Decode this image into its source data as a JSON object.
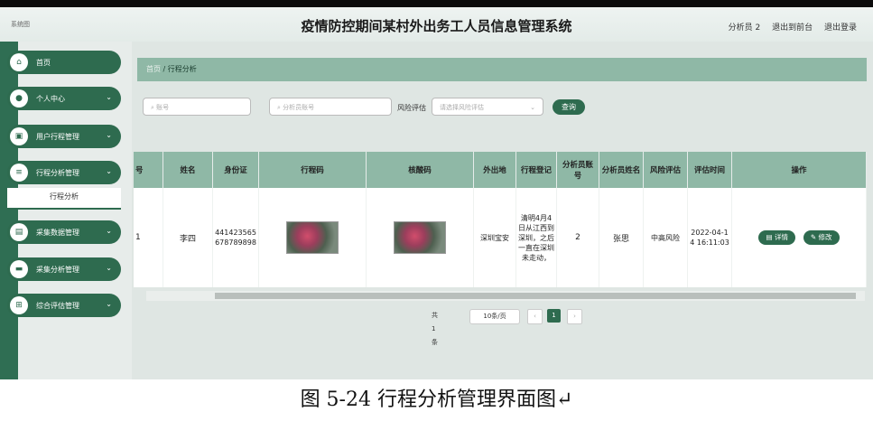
{
  "header": {
    "logo": "系统图",
    "title": "疫情防控期间某村外出务工人员信息管理系统",
    "user": "分析员 2",
    "front": "退出到前台",
    "logout": "退出登录"
  },
  "sidebar": {
    "items": [
      {
        "label": "首页",
        "icon": "home-icon",
        "glyph": "⌂"
      },
      {
        "label": "个人中心",
        "icon": "user-icon",
        "glyph": "●"
      },
      {
        "label": "用户行程管理",
        "icon": "clipboard-icon",
        "glyph": "▣"
      },
      {
        "label": "行程分析管理",
        "icon": "list-icon",
        "glyph": "≡"
      },
      {
        "label": "采集数据管理",
        "icon": "document-icon",
        "glyph": "▤"
      },
      {
        "label": "采集分析管理",
        "icon": "folder-icon",
        "glyph": "▬"
      },
      {
        "label": "综合评估管理",
        "icon": "grid-icon",
        "glyph": "⊞"
      }
    ],
    "sub": "行程分析"
  },
  "breadcrumb": {
    "home": "首页",
    "sep": "/",
    "current": "行程分析"
  },
  "filters": {
    "account_ph": "账号",
    "analyst_ph": "分析员账号",
    "risk_label": "风险评估",
    "risk_ph": "请选择风险评估",
    "query": "查询"
  },
  "table": {
    "headers": [
      "号",
      "姓名",
      "身份证",
      "行程码",
      "核酸码",
      "外出地",
      "行程登记",
      "分析员账号",
      "分析员姓名",
      "风险评估",
      "评估时间",
      "操作"
    ],
    "row": {
      "no": "1",
      "name": "李四",
      "id": "441423565678789898",
      "place": "深圳宝安",
      "record": "清明4月4日从江西到深圳，之后一直在深圳未走动，",
      "analyst_account": "2",
      "analyst_name": "张思",
      "risk": "中高风险",
      "time": "2022-04-14 16:11:03",
      "detail": "详情",
      "edit": "修改"
    }
  },
  "pager": {
    "total": "共 1 条",
    "size": "10条/页",
    "page": "1"
  },
  "caption": "图 5-24 行程分析管理界面图↵"
}
